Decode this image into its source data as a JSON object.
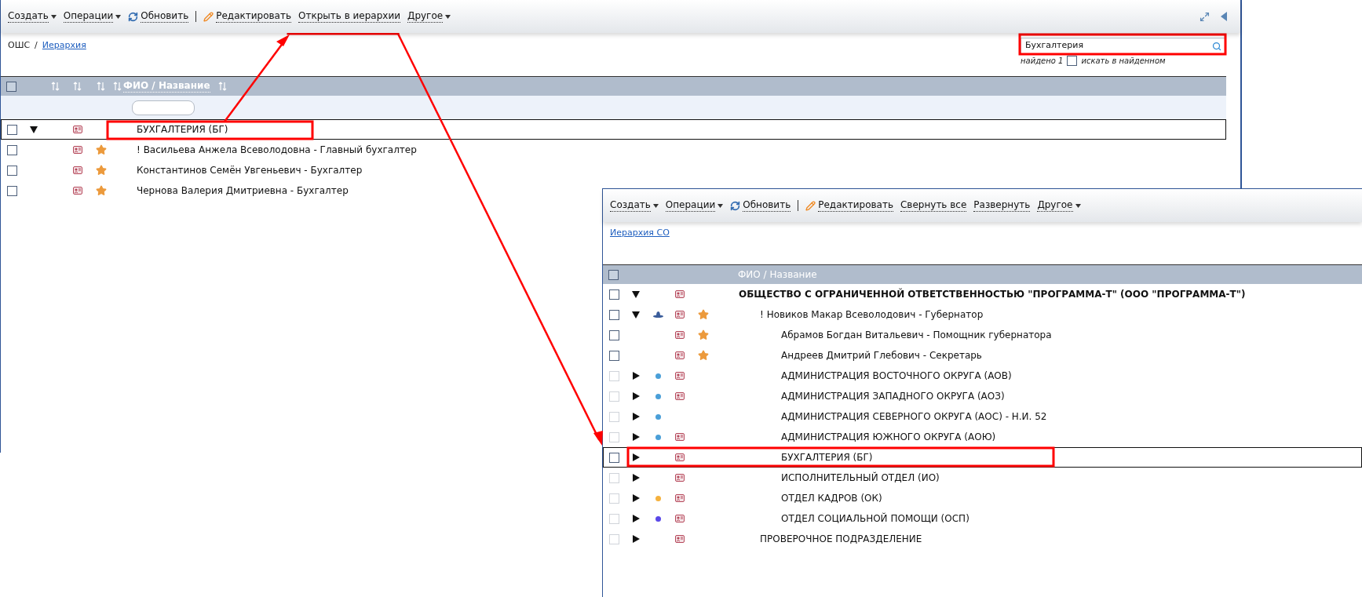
{
  "windows": [
    {
      "toolbar": [
        {
          "kind": "menu",
          "label": "Создать"
        },
        {
          "kind": "menu",
          "label": "Операции"
        },
        {
          "kind": "refresh",
          "label": "Обновить"
        },
        {
          "kind": "separator"
        },
        {
          "kind": "edit",
          "label": "Редактировать"
        },
        {
          "kind": "action",
          "label": "Открыть в иерархии"
        },
        {
          "kind": "menu",
          "label": "Другое"
        }
      ],
      "breadcrumb": {
        "separator": "/",
        "items": [
          {
            "label": "ОШС",
            "link": false
          },
          {
            "label": "Иерархия",
            "link": true
          }
        ]
      },
      "search": {
        "value": "Бухгалтерия",
        "result": "найдено 1",
        "within": {
          "label": "искать в найденном",
          "checked": false
        }
      },
      "table": {
        "header_checked": false,
        "filter_row": true,
        "columns": [
          {
            "kind": "icon",
            "sortable": true
          },
          {
            "kind": "icon",
            "sortable": true
          },
          {
            "kind": "icon",
            "sortable": true
          },
          {
            "kind": "text",
            "label": "ФИО / Название",
            "sortable": true
          },
          {
            "kind": "text",
            "sortable": true
          }
        ],
        "rows": [
          {
            "text": "БУХГАЛТЕРИЯ (БГ)",
            "kind": "item",
            "checked": false,
            "disabled": false,
            "expanded": true,
            "selected": true,
            "card": true,
            "star": false
          },
          {
            "text": "! Васильева Анжела Всеволодовна - Главный бухгалтер",
            "kind": "item",
            "checked": false,
            "disabled": false,
            "selected": false,
            "card": true,
            "star": true
          },
          {
            "text": "Константинов Семён Увгеньевич - Бухгалтер",
            "kind": "item",
            "checked": false,
            "disabled": false,
            "selected": false,
            "card": true,
            "star": true
          },
          {
            "text": "Чернова Валерия Дмитриевна - Бухгалтер",
            "kind": "item",
            "checked": false,
            "disabled": false,
            "selected": false,
            "card": true,
            "star": true
          }
        ]
      }
    },
    {
      "toolbar": [
        {
          "kind": "menu",
          "label": "Создать"
        },
        {
          "kind": "menu",
          "label": "Операции"
        },
        {
          "kind": "refresh",
          "label": "Обновить"
        },
        {
          "kind": "separator"
        },
        {
          "kind": "edit",
          "label": "Редактировать"
        },
        {
          "kind": "action",
          "label": "Свернуть все"
        },
        {
          "kind": "action",
          "label": "Развернуть"
        },
        {
          "kind": "menu",
          "label": "Другое"
        }
      ],
      "breadcrumb": {
        "items": [
          {
            "label": "Иерархия СО",
            "link": true
          }
        ]
      },
      "table": {
        "header_checked": false,
        "filter_row": false,
        "columns": [
          {
            "kind": "text",
            "label": "ФИО / Название",
            "sortable": false
          }
        ],
        "rows": [
          {
            "text": "ОБЩЕСТВО С ОГРАНИЧЕННОЙ ОТВЕТСТВЕННОСТЬЮ \"ПРОГРАММА-Т\" (ООО \"ПРОГРАММА-Т\")",
            "kind": "organization",
            "checked": false,
            "disabled": false,
            "expanded": true,
            "selected": false,
            "card": true,
            "star": false,
            "children": [
              {
                "text": "! Новиков Макар Всеволодович - Губернатор",
                "kind": "item",
                "checked": false,
                "disabled": false,
                "expanded": true,
                "selected": false,
                "role_icon": true,
                "card": true,
                "star": true,
                "children": [
                  {
                    "text": "Абрамов Богдан Витальевич - Помощник губернатора",
                    "kind": "item",
                    "checked": false,
                    "disabled": false,
                    "selected": false,
                    "card": true,
                    "star": true
                  },
                  {
                    "text": "Андреев Дмитрий Глебович - Секретарь",
                    "kind": "item",
                    "checked": false,
                    "disabled": false,
                    "selected": false,
                    "card": true,
                    "star": true
                  },
                  {
                    "text": "АДМИНИСТРАЦИЯ ВОСТОЧНОГО ОКРУГА (АОВ)",
                    "kind": "item",
                    "checked": false,
                    "disabled": true,
                    "expanded": false,
                    "selected": false,
                    "color": "#4a9fd8",
                    "card": true,
                    "star": false
                  },
                  {
                    "text": "АДМИНИСТРАЦИЯ ЗАПАДНОГО ОКРУГА (АОЗ)",
                    "kind": "item",
                    "checked": false,
                    "disabled": true,
                    "expanded": false,
                    "selected": false,
                    "color": "#4a9fd8",
                    "card": true,
                    "star": false
                  },
                  {
                    "text": "АДМИНИСТРАЦИЯ СЕВЕРНОГО ОКРУГА (АОС) - Н.И. 52",
                    "kind": "item",
                    "checked": false,
                    "disabled": true,
                    "expanded": false,
                    "selected": false,
                    "color": "#4a9fd8",
                    "card": false,
                    "star": false
                  },
                  {
                    "text": "АДМИНИСТРАЦИЯ ЮЖНОГО ОКРУГА (АОЮ)",
                    "kind": "item",
                    "checked": false,
                    "disabled": true,
                    "expanded": false,
                    "selected": false,
                    "color": "#4a9fd8",
                    "card": true,
                    "star": false
                  },
                  {
                    "text": "БУХГАЛТЕРИЯ (БГ)",
                    "kind": "item",
                    "checked": false,
                    "disabled": false,
                    "expanded": false,
                    "selected": true,
                    "card": true,
                    "star": false
                  },
                  {
                    "text": "ИСПОЛНИТЕЛЬНЫЙ ОТДЕЛ (ИО)",
                    "kind": "item",
                    "checked": false,
                    "disabled": true,
                    "expanded": false,
                    "selected": false,
                    "card": true,
                    "star": false
                  },
                  {
                    "text": "ОТДЕЛ КАДРОВ (ОК)",
                    "kind": "item",
                    "checked": false,
                    "disabled": true,
                    "expanded": false,
                    "selected": false,
                    "color": "#f5b13d",
                    "card": true,
                    "star": false
                  },
                  {
                    "text": "ОТДЕЛ СОЦИАЛЬНОЙ ПОМОЩИ (ОСП)",
                    "kind": "item",
                    "checked": false,
                    "disabled": true,
                    "expanded": false,
                    "selected": false,
                    "color": "#5a48e8",
                    "card": true,
                    "star": false
                  }
                ]
              },
              {
                "text": "ПРОВЕРОЧНОЕ ПОДРАЗДЕЛЕНИЕ",
                "kind": "item",
                "checked": false,
                "disabled": true,
                "expanded": false,
                "selected": false,
                "card": true,
                "star": false
              }
            ]
          }
        ]
      }
    }
  ]
}
